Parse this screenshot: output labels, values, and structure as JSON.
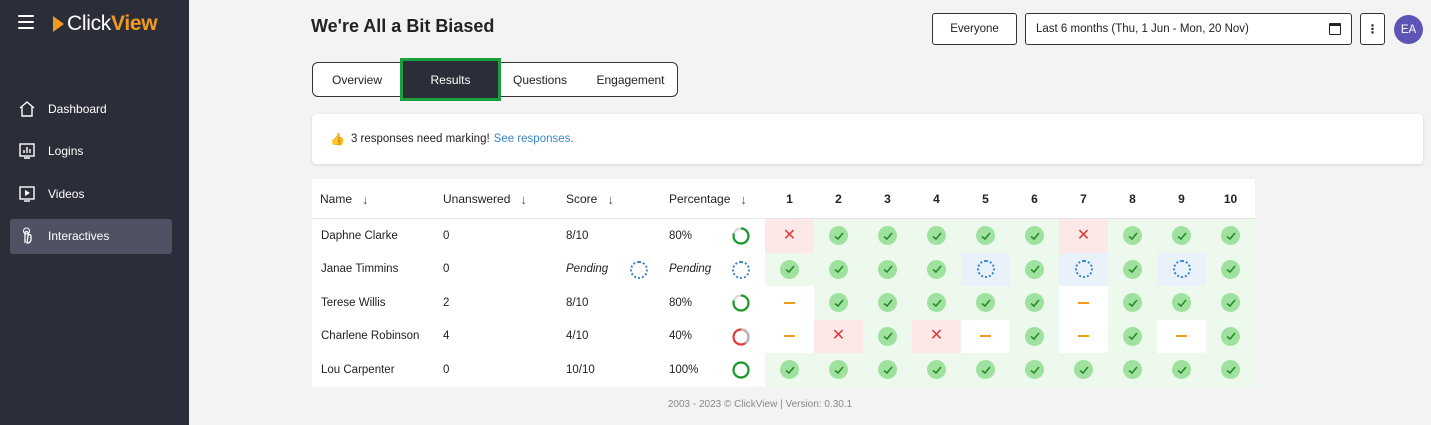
{
  "app": {
    "logo_click": "Click",
    "logo_view": "View"
  },
  "sidebar": {
    "items": [
      {
        "label": "Dashboard",
        "icon": "home-icon"
      },
      {
        "label": "Logins",
        "icon": "logins-icon"
      },
      {
        "label": "Videos",
        "icon": "video-icon"
      },
      {
        "label": "Interactives",
        "icon": "interactives-icon",
        "active": true
      }
    ]
  },
  "header": {
    "title": "We're All a Bit Biased",
    "audience": "Everyone",
    "date_range": "Last 6 months (Thu, 1 Jun - Mon, 20 Nov)",
    "avatar_initials": "EA"
  },
  "tabs": [
    {
      "label": "Overview"
    },
    {
      "label": "Results",
      "active": true
    },
    {
      "label": "Questions"
    },
    {
      "label": "Engagement"
    }
  ],
  "notice": {
    "text": "3 responses need marking!",
    "link": "See responses."
  },
  "table": {
    "columns": [
      "Name",
      "Unanswered",
      "Score",
      "Percentage"
    ],
    "questions": [
      "1",
      "2",
      "3",
      "4",
      "5",
      "6",
      "7",
      "8",
      "9",
      "10"
    ],
    "rows": [
      {
        "name": "Daphne Clarke",
        "unanswered": "0",
        "score": "8/10",
        "percentage": "80%",
        "pct_value": 0.8,
        "results": [
          "wrong",
          "correct",
          "correct",
          "correct",
          "correct",
          "correct",
          "wrong",
          "correct",
          "correct",
          "correct"
        ]
      },
      {
        "name": "Janae Timmins",
        "unanswered": "0",
        "score": "Pending",
        "percentage": "Pending",
        "pct_value": null,
        "results": [
          "correct",
          "correct",
          "correct",
          "correct",
          "pending",
          "correct",
          "pending",
          "correct",
          "pending",
          "correct"
        ]
      },
      {
        "name": "Terese Willis",
        "unanswered": "2",
        "score": "8/10",
        "percentage": "80%",
        "pct_value": 0.8,
        "results": [
          "unanswered",
          "correct",
          "correct",
          "correct",
          "correct",
          "correct",
          "unanswered",
          "correct",
          "correct",
          "correct"
        ]
      },
      {
        "name": "Charlene Robinson",
        "unanswered": "4",
        "score": "4/10",
        "percentage": "40%",
        "pct_value": 0.4,
        "results": [
          "unanswered",
          "wrong",
          "correct",
          "wrong",
          "unanswered",
          "correct",
          "unanswered",
          "correct",
          "unanswered",
          "correct"
        ]
      },
      {
        "name": "Lou Carpenter",
        "unanswered": "0",
        "score": "10/10",
        "percentage": "100%",
        "pct_value": 1.0,
        "results": [
          "correct",
          "correct",
          "correct",
          "correct",
          "correct",
          "correct",
          "correct",
          "correct",
          "correct",
          "correct"
        ]
      }
    ]
  },
  "footer": "2003 - 2023 © ClickView | Version: 0.30.1",
  "colors": {
    "sidebar_bg": "#2b2e38",
    "accent_orange": "#f29a1d",
    "correct_green": "#9fe29f",
    "wrong_red": "#e03b3b",
    "pending_blue": "#3a86c8",
    "tab_highlight": "#1aa03b",
    "avatar_bg": "#5c55b5"
  }
}
